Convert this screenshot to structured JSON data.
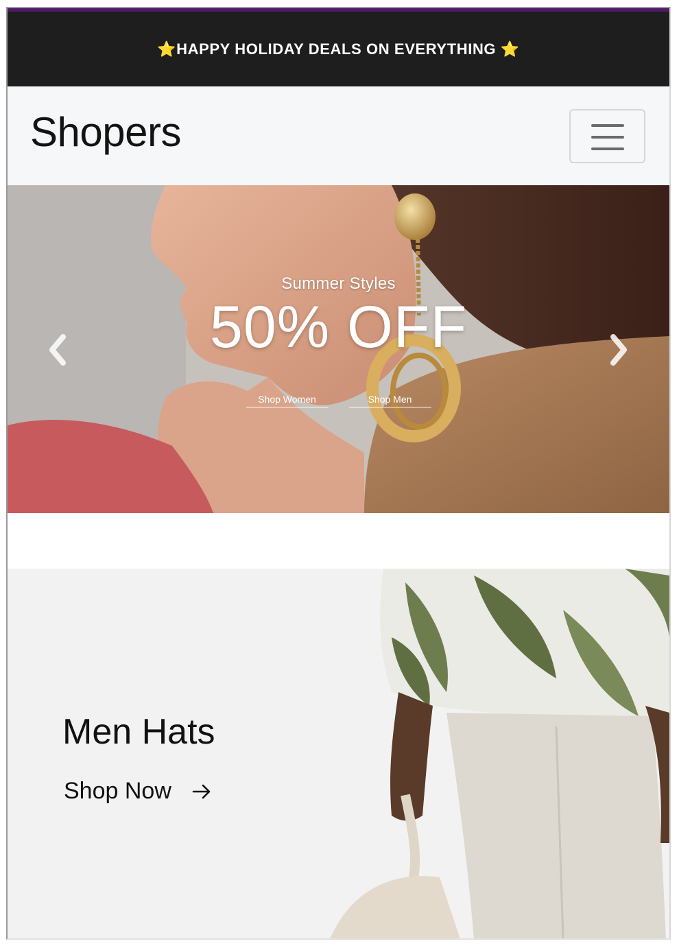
{
  "promo_bar": {
    "star_left": "⭐",
    "text": "HAPPY HOLIDAY DEALS ON EVERYTHING",
    "star_right": "⭐"
  },
  "navbar": {
    "brand": "Shopers",
    "toggle_icon": "hamburger-menu-icon"
  },
  "hero": {
    "subtitle": "Summer Styles",
    "title": "50% OFF",
    "links": [
      "Shop Women",
      "Shop Men"
    ],
    "prev_icon": "chevron-left-icon",
    "next_icon": "chevron-right-icon"
  },
  "promo_card": {
    "title": "Men Hats",
    "cta": "Shop Now",
    "cta_icon": "arrow-right-icon"
  },
  "colors": {
    "promo_bg": "#1e1e1e",
    "promo_accent": "#4e1a69",
    "navbar_bg": "#f6f7f9",
    "star": "#f7c531"
  }
}
